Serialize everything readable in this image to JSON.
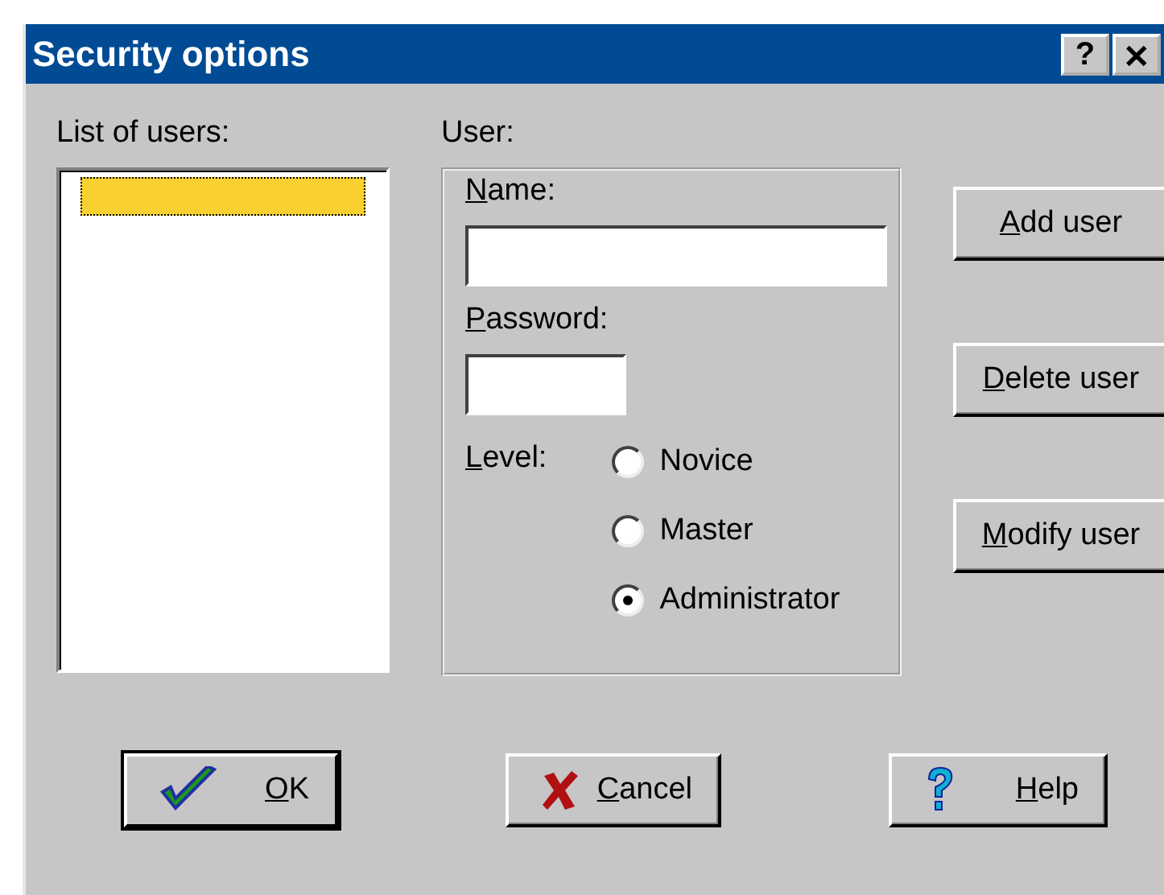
{
  "window": {
    "title": "Security options",
    "title_buttons": [
      "?",
      "✕"
    ]
  },
  "users_list": {
    "label": "List of users:",
    "items": [
      {
        "selected": true
      }
    ]
  },
  "user_group": {
    "label": "User:",
    "name_field": {
      "label": "Name:"
    },
    "password_field": {
      "label": "Password:"
    },
    "level": {
      "label": "Level:",
      "options": [
        {
          "label": "Novice",
          "selected": false
        },
        {
          "label": "Master",
          "selected": false
        },
        {
          "label": "Administrator",
          "selected": true
        }
      ]
    }
  },
  "side_buttons": [
    {
      "label": "Add user"
    },
    {
      "label": "Delete user"
    },
    {
      "label": "Modify user"
    }
  ],
  "bottom_buttons": [
    {
      "kind": "ok",
      "label": "OK",
      "default": true
    },
    {
      "kind": "cancel",
      "label": "Cancel",
      "default": false
    },
    {
      "kind": "help",
      "label": "Help",
      "default": false
    }
  ]
}
